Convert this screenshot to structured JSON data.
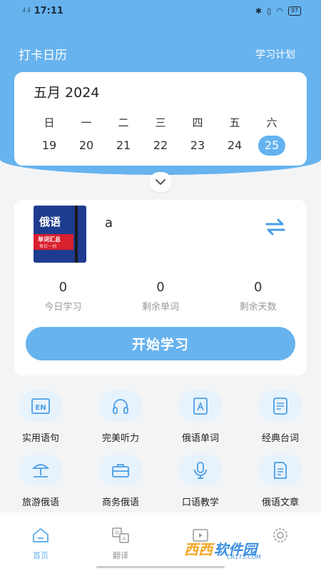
{
  "status": {
    "time": "17:11",
    "signal": ".ıl .ıl",
    "battery": "97"
  },
  "header": {
    "title": "打卡日历",
    "plan_link": "学习计划"
  },
  "calendar": {
    "month": "五月 2024",
    "weekdays": [
      "日",
      "一",
      "二",
      "三",
      "四",
      "五",
      "六"
    ],
    "dates": [
      "19",
      "20",
      "21",
      "22",
      "23",
      "24",
      "25"
    ],
    "selected": "25"
  },
  "study": {
    "book_title": "俄语",
    "book_band_1": "单词汇总",
    "book_band_2": "每日一词",
    "current_word": "a",
    "stats": [
      {
        "value": "0",
        "label": "今日学习"
      },
      {
        "value": "0",
        "label": "剩余单词"
      },
      {
        "value": "0",
        "label": "剩余天数"
      }
    ],
    "start_label": "开始学习"
  },
  "features": [
    {
      "label": "实用语句",
      "icon": "en-icon"
    },
    {
      "label": "完美听力",
      "icon": "headphones-icon"
    },
    {
      "label": "俄语单词",
      "icon": "word-book-icon"
    },
    {
      "label": "经典台词",
      "icon": "document-icon"
    },
    {
      "label": "旅游俄语",
      "icon": "beach-icon"
    },
    {
      "label": "商务俄语",
      "icon": "briefcase-icon"
    },
    {
      "label": "口语教学",
      "icon": "microphone-icon"
    },
    {
      "label": "俄语文章",
      "icon": "article-icon"
    }
  ],
  "tabs": [
    {
      "label": "首页",
      "icon": "home-icon",
      "active": true
    },
    {
      "label": "翻译",
      "icon": "translate-icon",
      "active": false
    },
    {
      "label": "",
      "icon": "video-icon",
      "active": false
    },
    {
      "label": "",
      "icon": "settings-icon",
      "active": false
    }
  ],
  "watermark": {
    "text1": "西西",
    "text2": "软件园",
    "sub": "CR173.COM"
  },
  "colors": {
    "primary": "#67b3ee",
    "icon_bg": "#e6f2fc",
    "background": "#f3f4f6"
  }
}
